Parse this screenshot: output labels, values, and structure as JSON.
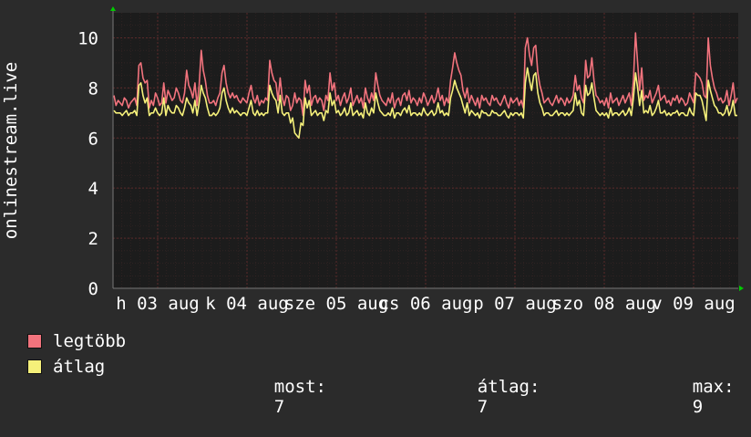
{
  "chart_data": {
    "type": "line",
    "ylabel": "onlinestream.live",
    "ylim": [
      0,
      11
    ],
    "yticks": [
      "0",
      "2",
      "4",
      "6",
      "8",
      "10"
    ],
    "xticks": [
      "h 03 aug",
      "k 04 aug",
      "sze 05 aug",
      "cs 06 aug",
      "p 07 aug",
      "szo 08 aug",
      "v 09 aug"
    ],
    "grid": true,
    "colors": {
      "background": "#2b2b2b",
      "plot": "#1c1c1c",
      "grid": "#5a2a2a",
      "arrows": "#00cc00",
      "max": "#f2737d",
      "avg": "#f5f07a"
    },
    "series": [
      {
        "name": "legtöbb",
        "color": "#f2737d",
        "values": [
          7.7,
          7.3,
          7.5,
          7.4,
          7.3,
          7.6,
          7.5,
          7.2,
          7.4,
          7.5,
          7.6,
          7.3,
          8.9,
          9.0,
          8.4,
          8.2,
          8.3,
          7.2,
          7.5,
          7.3,
          7.8,
          7.6,
          7.3,
          7.4,
          8.2,
          7.4,
          7.9,
          7.7,
          7.5,
          7.6,
          8.0,
          7.8,
          7.5,
          7.4,
          7.8,
          8.7,
          8.1,
          7.9,
          7.6,
          8.2,
          7.3,
          8.1,
          9.5,
          8.7,
          8.3,
          7.7,
          7.4,
          7.4,
          7.5,
          7.3,
          7.6,
          7.8,
          8.6,
          8.9,
          8.2,
          7.8,
          7.6,
          7.8,
          7.6,
          7.7,
          7.5,
          7.4,
          7.6,
          7.5,
          7.4,
          7.8,
          8.1,
          7.6,
          7.4,
          7.7,
          7.3,
          7.5,
          7.4,
          7.6,
          7.5,
          9.1,
          8.6,
          8.3,
          8.2,
          7.5,
          8.4,
          7.6,
          7.3,
          7.7,
          7.6,
          7.1,
          7.3,
          7.8,
          7.4,
          7.6,
          7.5,
          6.9,
          8.3,
          7.8,
          8.1,
          7.3,
          7.6,
          7.7,
          7.4,
          7.6,
          7.5,
          7.1,
          7.7,
          7.5,
          8.6,
          7.9,
          8.2,
          7.5,
          7.7,
          7.3,
          7.6,
          7.8,
          7.4,
          7.6,
          8.0,
          7.3,
          7.5,
          7.7,
          7.4,
          7.6,
          7.2,
          8.0,
          7.6,
          7.4,
          7.8,
          7.5,
          8.6,
          8.1,
          7.7,
          7.5,
          7.4,
          7.3,
          7.6,
          7.4,
          7.8,
          7.2,
          7.5,
          7.6,
          7.3,
          7.7,
          7.8,
          7.5,
          7.9,
          7.4,
          7.6,
          7.5,
          7.3,
          7.6,
          7.4,
          7.8,
          7.6,
          7.3,
          7.5,
          7.7,
          7.4,
          7.6,
          8.0,
          7.5,
          7.7,
          7.3,
          7.6,
          7.4,
          8.3,
          8.8,
          9.4,
          9.0,
          8.7,
          8.5,
          7.9,
          7.6,
          8.0,
          7.4,
          7.7,
          7.5,
          7.3,
          7.6,
          7.2,
          7.7,
          7.5,
          7.6,
          7.4,
          7.3,
          7.7,
          7.5,
          7.6,
          7.4,
          7.3,
          7.5,
          7.7,
          7.4,
          7.2,
          7.6,
          7.4,
          7.5,
          7.6,
          7.3,
          7.5,
          7.2,
          9.6,
          10.0,
          9.3,
          8.9,
          9.6,
          9.7,
          8.6,
          8.1,
          7.8,
          7.4,
          7.5,
          7.6,
          7.4,
          7.3,
          7.5,
          7.7,
          7.4,
          7.6,
          7.5,
          7.3,
          7.6,
          7.4,
          7.5,
          7.7,
          8.5,
          7.9,
          8.1,
          7.6,
          7.4,
          9.1,
          8.4,
          8.5,
          9.2,
          8.3,
          7.7,
          7.6,
          7.4,
          7.5,
          7.3,
          7.6,
          7.2,
          7.8,
          7.4,
          7.5,
          7.6,
          7.3,
          7.5,
          7.7,
          7.4,
          7.6,
          7.8,
          7.3,
          8.3,
          10.2,
          9.0,
          7.9,
          8.8,
          7.5,
          7.7,
          7.6,
          7.9,
          7.4,
          7.6,
          7.8,
          8.1,
          7.5,
          7.6,
          7.7,
          7.4,
          7.5,
          7.3,
          7.6,
          7.5,
          7.7,
          7.4,
          7.6,
          7.5,
          7.3,
          7.4,
          7.8,
          7.6,
          7.4,
          8.6,
          8.5,
          8.4,
          8.2,
          7.7,
          7.6,
          10.0,
          8.9,
          8.4,
          8.0,
          7.8,
          7.5,
          7.6,
          7.4,
          7.5,
          7.9,
          7.3,
          7.7,
          8.2,
          7.4,
          7.6
        ]
      },
      {
        "name": "átlag",
        "color": "#f5f07a",
        "values": [
          7.1,
          7.0,
          7.0,
          7.0,
          6.9,
          7.0,
          7.1,
          6.9,
          7.0,
          7.0,
          7.1,
          6.9,
          8.1,
          8.2,
          7.7,
          7.4,
          7.6,
          6.9,
          7.0,
          7.0,
          7.2,
          7.0,
          6.9,
          7.0,
          7.6,
          6.9,
          7.3,
          7.1,
          7.0,
          7.0,
          7.3,
          7.2,
          7.0,
          6.9,
          7.2,
          7.6,
          7.4,
          7.3,
          7.0,
          7.5,
          6.9,
          7.4,
          8.1,
          7.8,
          7.6,
          7.2,
          6.9,
          6.9,
          7.0,
          6.9,
          7.0,
          7.2,
          7.8,
          8.0,
          7.5,
          7.2,
          7.0,
          7.2,
          7.0,
          7.1,
          7.0,
          6.9,
          7.0,
          7.0,
          6.9,
          7.2,
          7.5,
          7.0,
          6.9,
          7.1,
          6.9,
          7.0,
          6.9,
          7.0,
          7.0,
          8.1,
          7.8,
          7.6,
          7.5,
          7.0,
          7.7,
          7.0,
          6.9,
          7.0,
          7.0,
          6.6,
          6.8,
          6.2,
          6.1,
          6.0,
          6.6,
          6.5,
          7.6,
          7.2,
          7.5,
          6.9,
          7.0,
          7.1,
          6.9,
          7.0,
          7.0,
          6.7,
          7.1,
          7.0,
          7.8,
          7.3,
          7.5,
          7.0,
          7.1,
          6.9,
          7.0,
          7.2,
          6.9,
          7.0,
          7.4,
          6.9,
          7.0,
          7.1,
          6.9,
          7.0,
          6.8,
          7.4,
          7.0,
          6.9,
          7.2,
          7.0,
          7.8,
          7.4,
          7.1,
          7.0,
          6.9,
          6.9,
          7.0,
          6.9,
          7.2,
          6.8,
          7.0,
          7.0,
          6.9,
          7.1,
          7.2,
          7.0,
          7.3,
          6.9,
          7.0,
          7.0,
          6.9,
          7.0,
          6.9,
          7.2,
          7.0,
          6.9,
          7.0,
          7.1,
          6.9,
          7.0,
          7.4,
          7.0,
          7.1,
          6.9,
          7.0,
          6.9,
          7.6,
          7.9,
          8.3,
          8.0,
          7.8,
          7.6,
          7.3,
          7.0,
          7.4,
          6.9,
          7.1,
          7.0,
          6.9,
          7.0,
          6.8,
          7.1,
          7.0,
          7.0,
          6.9,
          6.9,
          7.1,
          7.0,
          7.0,
          6.9,
          6.9,
          7.0,
          7.1,
          6.9,
          6.8,
          7.0,
          6.9,
          7.0,
          7.0,
          6.9,
          7.0,
          6.8,
          8.2,
          8.8,
          8.3,
          7.9,
          8.5,
          8.6,
          7.8,
          7.4,
          7.2,
          6.9,
          7.0,
          7.0,
          6.9,
          6.9,
          7.0,
          7.1,
          6.9,
          7.0,
          7.0,
          6.9,
          7.0,
          6.9,
          7.0,
          7.1,
          7.8,
          7.3,
          7.5,
          7.0,
          6.9,
          8.1,
          7.7,
          7.8,
          8.2,
          7.6,
          7.1,
          7.0,
          6.9,
          7.0,
          6.9,
          7.0,
          6.8,
          7.2,
          6.9,
          7.0,
          7.0,
          6.9,
          7.0,
          7.1,
          6.9,
          7.0,
          7.2,
          6.9,
          7.6,
          8.6,
          8.0,
          7.3,
          7.9,
          7.0,
          7.1,
          7.0,
          7.3,
          6.9,
          7.0,
          7.2,
          7.5,
          7.0,
          7.0,
          7.1,
          6.9,
          7.0,
          6.9,
          7.0,
          7.0,
          7.1,
          6.9,
          7.0,
          7.0,
          6.9,
          6.9,
          7.2,
          7.0,
          6.9,
          7.8,
          7.7,
          7.7,
          7.5,
          7.1,
          6.7,
          8.3,
          7.9,
          7.6,
          7.3,
          7.2,
          7.0,
          7.0,
          6.9,
          7.0,
          7.3,
          6.9,
          7.1,
          7.5,
          6.9,
          6.9
        ]
      }
    ]
  },
  "stats": {
    "now_label": "most:",
    "now_value": "7",
    "avg_label": "átlag:",
    "avg_value": "7",
    "max_label": "max:",
    "max_value": "9"
  }
}
